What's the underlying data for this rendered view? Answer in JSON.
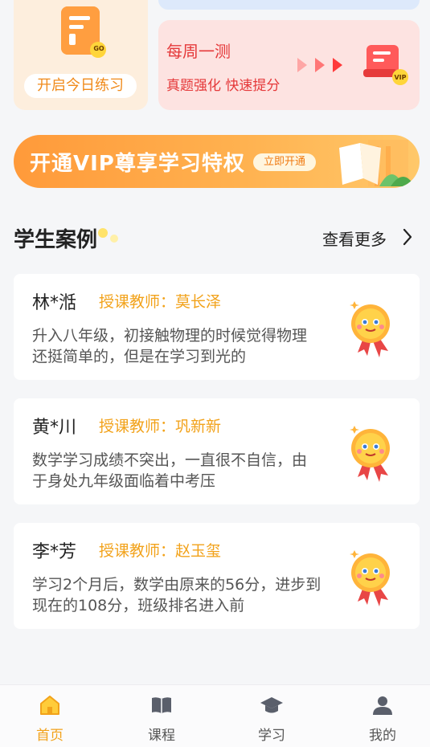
{
  "daily_card": {
    "button_label": "开启今日练习",
    "icon_badge": "GO"
  },
  "weekly_card": {
    "title": "每周一测",
    "subtitle": "真题强化 快速提分",
    "icon_badge": "VIP"
  },
  "vip_banner": {
    "text": "开通VIP尊享学习特权",
    "button_label": "立即开通"
  },
  "section": {
    "title": "学生案例",
    "see_more": "查看更多"
  },
  "cases": [
    {
      "name": "林*湉",
      "teacher": "授课教师：莫长泽",
      "text": "升入八年级，初接触物理的时候觉得物理还挺简单的，但是在学习到光的"
    },
    {
      "name": "黄*川",
      "teacher": "授课教师：巩新新",
      "text": "数学学习成绩不突出，一直很不自信，由于身处九年级面临着中考压"
    },
    {
      "name": "李*芳",
      "teacher": "授课教师：赵玉玺",
      "text": "学习2个月后，数学由原来的56分，进步到现在的108分，班级排名进入前"
    }
  ],
  "tabbar": {
    "items": [
      {
        "label": "首页",
        "icon": "home-icon",
        "active": true
      },
      {
        "label": "课程",
        "icon": "book-icon",
        "active": false
      },
      {
        "label": "学习",
        "icon": "graduation-cap-icon",
        "active": false
      },
      {
        "label": "我的",
        "icon": "user-icon",
        "active": false
      }
    ]
  },
  "colors": {
    "accent": "#f2a21a",
    "weekly_red": "#e5393a",
    "banner_orange": "#ff9a3a"
  }
}
